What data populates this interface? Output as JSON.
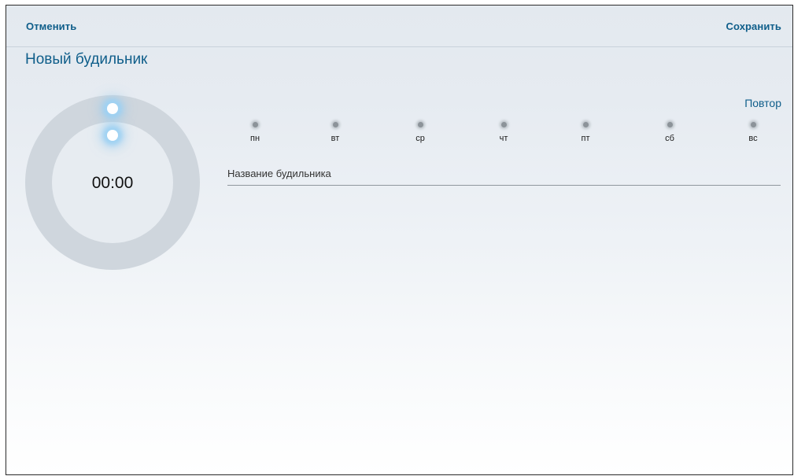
{
  "header": {
    "cancel_label": "Отменить",
    "save_label": "Сохранить"
  },
  "page": {
    "title": "Новый будильник"
  },
  "clock": {
    "time": "00:00"
  },
  "repeat": {
    "label": "Повтор",
    "days": [
      "пн",
      "вт",
      "ср",
      "чт",
      "пт",
      "сб",
      "вс"
    ]
  },
  "alarm_name": {
    "placeholder": "Название будильника"
  },
  "colors": {
    "accent": "#0f5e8a",
    "dial_track": "#cfd6dd",
    "handle_glow": "#9fd2f3"
  },
  "icons": {
    "day_marker": "dot-icon",
    "dial_handle": "glow-handle-icon"
  }
}
